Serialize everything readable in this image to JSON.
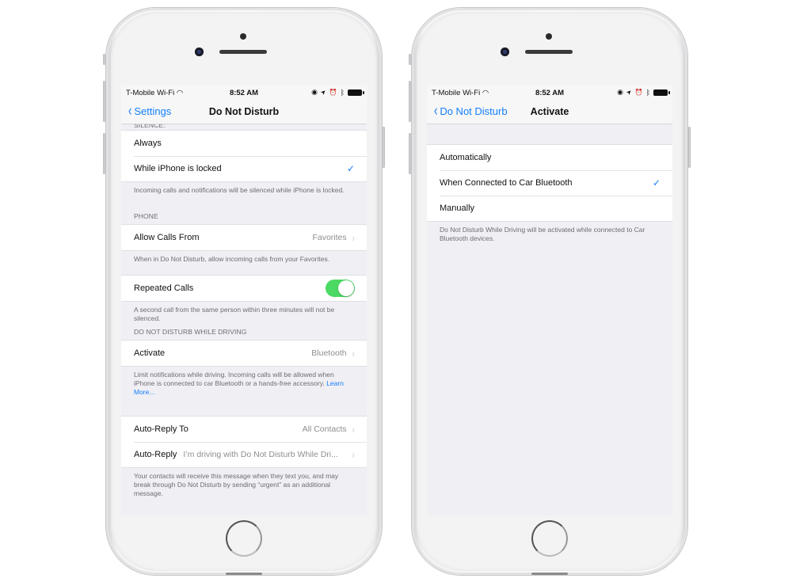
{
  "status_bar": {
    "carrier": "T-Mobile Wi-Fi",
    "wifi_icon": "wifi-icon",
    "time": "8:52 AM",
    "icons": [
      "orientation-lock-icon",
      "location-icon",
      "alarm-icon",
      "bluetooth-icon",
      "battery-icon"
    ]
  },
  "left_screen": {
    "back_label": "Settings",
    "title": "Do Not Disturb",
    "silence_header": "SILENCE:",
    "silence_options": [
      {
        "label": "Always",
        "checked": false
      },
      {
        "label": "While iPhone is locked",
        "checked": true
      }
    ],
    "silence_footer": "Incoming calls and notifications will be silenced while iPhone is locked.",
    "phone_header": "PHONE",
    "allow_calls": {
      "label": "Allow Calls From",
      "value": "Favorites"
    },
    "allow_calls_footer": "When in Do Not Disturb, allow incoming calls from your Favorites.",
    "repeated_calls": {
      "label": "Repeated Calls",
      "on": true
    },
    "repeated_calls_footer": "A second call from the same person within three minutes will not be silenced.",
    "driving_header": "DO NOT DISTURB WHILE DRIVING",
    "activate": {
      "label": "Activate",
      "value": "Bluetooth"
    },
    "driving_footer": "Limit notifications while driving. Incoming calls will be allowed when iPhone is connected to car Bluetooth or a hands-free accessory.",
    "learn_more": "Learn More...",
    "auto_reply_to": {
      "label": "Auto-Reply To",
      "value": "All Contacts"
    },
    "auto_reply": {
      "label": "Auto-Reply",
      "value": "I’m driving with Do Not Disturb While Dri..."
    },
    "auto_reply_footer": "Your contacts will receive this message when they text you, and may break through Do Not Disturb by sending “urgent” as an additional message."
  },
  "right_screen": {
    "back_label": "Do Not Disturb",
    "title": "Activate",
    "options": [
      {
        "label": "Automatically",
        "checked": false
      },
      {
        "label": "When Connected to Car Bluetooth",
        "checked": true
      },
      {
        "label": "Manually",
        "checked": false
      }
    ],
    "footer": "Do Not Disturb While Driving will be activated while connected to Car Bluetooth devices."
  },
  "glyphs": {
    "check": "✓",
    "chevron": "›",
    "back_chevron": "‹",
    "wifi": "◠",
    "orientation_lock": "◉",
    "location": "➤",
    "alarm": "⏰",
    "bluetooth": "ᛒ"
  },
  "colors": {
    "accent": "#147efb",
    "toggle_on": "#4cd964",
    "background": "#efeff4"
  }
}
